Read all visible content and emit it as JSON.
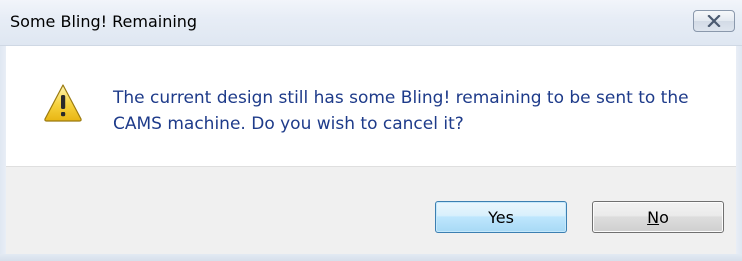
{
  "window": {
    "title": "Some Bling! Remaining",
    "close_icon": "close-icon"
  },
  "dialog": {
    "icon": "warning-icon",
    "message_line1": "The current design still has some Bling! remaining to be sent to the",
    "message_line2": "CAMS machine. Do you wish to cancel it?"
  },
  "buttons": {
    "yes_label": "Yes",
    "no_label_mnemonic": "N",
    "no_label_rest": "o"
  },
  "colors": {
    "message_text": "#1e3b8a",
    "warning_fill": "#f6d23e",
    "footer_bg": "#f0f0f0",
    "default_button_border": "#3c7fb1"
  }
}
